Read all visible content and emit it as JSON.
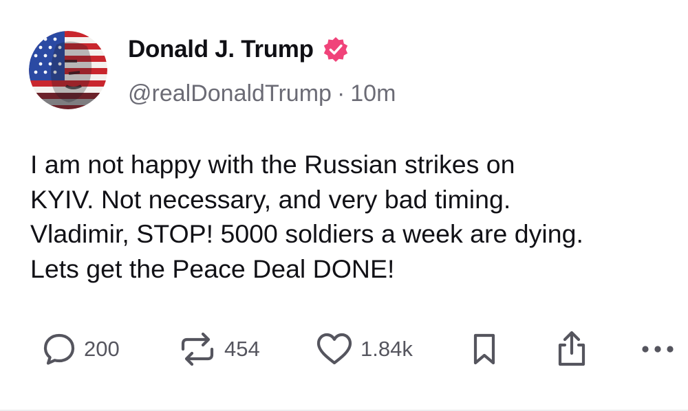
{
  "author": {
    "display_name": "Donald J. Trump",
    "handle": "@realDonaldTrump",
    "separator": "·",
    "timestamp": "10m",
    "verified_icon": "verified-badge-icon",
    "avatar_icon": "flag-portrait-avatar"
  },
  "post": {
    "text": "I am not happy with the Russian strikes on\nKYIV. Not necessary, and very bad timing.\nVladimir, STOP! 5000 soldiers a week are dying.\nLets get the Peace Deal DONE!"
  },
  "actions": {
    "replies": {
      "icon": "reply-icon",
      "count": "200"
    },
    "reposts": {
      "icon": "repost-icon",
      "count": "454"
    },
    "likes": {
      "icon": "heart-icon",
      "count": "1.84k"
    },
    "bookmark": {
      "icon": "bookmark-icon"
    },
    "share": {
      "icon": "share-icon"
    },
    "more": {
      "icon": "more-icon"
    }
  },
  "colors": {
    "verified_badge": "#f0437a",
    "icon_gray": "#55555e",
    "handle_gray": "#6b6b75",
    "text": "#111116"
  }
}
